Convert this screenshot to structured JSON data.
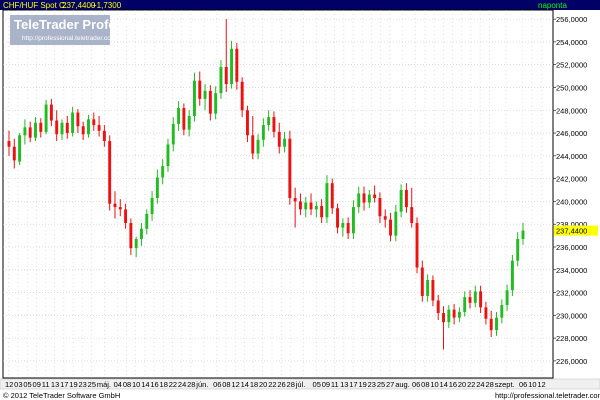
{
  "header": {
    "symbol": "CHF/HUF Spot C:",
    "last": "237,4400",
    "change": "+1,7300",
    "interval": "naponta"
  },
  "watermark": {
    "title": "TeleTrader Professional",
    "url": "http://professional.teletrader.com"
  },
  "footer": {
    "copyright": "© 2012 TeleTrader Software GmbH",
    "url": "http://professional.teletrader.com"
  },
  "colors": {
    "up": "#22bb22",
    "down": "#ee1111",
    "header_bg": "#000066",
    "header_text": "#ffff00",
    "grid": "#c8c8c8",
    "last_price_bg": "#ffff00",
    "bottom_bar": "#f0f0f0"
  },
  "chart_data": {
    "type": "candlestick",
    "ylim": [
      224.5,
      256.8
    ],
    "y_ticks": [
      "256,0000",
      "254,0000",
      "252,0000",
      "250,0000",
      "248,0000",
      "246,0000",
      "244,0000",
      "242,0000",
      "240,0000",
      "238,0000",
      "236,0000",
      "234,0000",
      "232,0000",
      "230,0000",
      "228,0000",
      "226,0000"
    ],
    "last_price_label": "237,4400",
    "x_tick_labels": [
      "12",
      "03",
      "05",
      "09",
      "11",
      "13",
      "17",
      "19",
      "23",
      "25",
      "máj.",
      "04",
      "08",
      "10",
      "14",
      "16",
      "18",
      "22",
      "24",
      "28",
      "jún.",
      "06",
      "08",
      "12",
      "14",
      "18",
      "20",
      "22",
      "26",
      "28",
      "júl.",
      "05",
      "09",
      "11",
      "13",
      "17",
      "19",
      "23",
      "25",
      "27",
      "aug.",
      "06",
      "08",
      "10",
      "14",
      "16",
      "20",
      "22",
      "24",
      "28",
      "szept.",
      "06",
      "10",
      "12"
    ],
    "candles": [
      {
        "o": 245.3,
        "h": 246.2,
        "l": 244.0,
        "c": 244.8
      },
      {
        "o": 244.8,
        "h": 245.5,
        "l": 242.9,
        "c": 243.6
      },
      {
        "o": 243.5,
        "h": 246.0,
        "l": 243.2,
        "c": 245.8
      },
      {
        "o": 245.8,
        "h": 247.2,
        "l": 245.0,
        "c": 246.5
      },
      {
        "o": 246.5,
        "h": 247.0,
        "l": 245.2,
        "c": 245.6
      },
      {
        "o": 245.6,
        "h": 247.4,
        "l": 245.3,
        "c": 246.9
      },
      {
        "o": 246.9,
        "h": 247.3,
        "l": 245.6,
        "c": 246.1
      },
      {
        "o": 246.1,
        "h": 248.9,
        "l": 245.9,
        "c": 248.5
      },
      {
        "o": 248.5,
        "h": 249.0,
        "l": 246.6,
        "c": 247.1
      },
      {
        "o": 247.1,
        "h": 248.0,
        "l": 245.3,
        "c": 245.9
      },
      {
        "o": 245.9,
        "h": 247.2,
        "l": 245.4,
        "c": 246.9
      },
      {
        "o": 246.9,
        "h": 247.5,
        "l": 245.5,
        "c": 246.0
      },
      {
        "o": 246.0,
        "h": 248.3,
        "l": 245.7,
        "c": 247.8
      },
      {
        "o": 247.8,
        "h": 248.1,
        "l": 246.0,
        "c": 246.6
      },
      {
        "o": 246.6,
        "h": 247.0,
        "l": 245.4,
        "c": 245.9
      },
      {
        "o": 245.9,
        "h": 247.6,
        "l": 245.6,
        "c": 247.2
      },
      {
        "o": 247.2,
        "h": 247.8,
        "l": 246.2,
        "c": 246.7
      },
      {
        "o": 246.7,
        "h": 247.5,
        "l": 245.7,
        "c": 246.2
      },
      {
        "o": 246.2,
        "h": 246.7,
        "l": 244.8,
        "c": 245.3
      },
      {
        "o": 245.3,
        "h": 245.8,
        "l": 239.2,
        "c": 239.8
      },
      {
        "o": 239.8,
        "h": 240.9,
        "l": 238.5,
        "c": 239.5
      },
      {
        "o": 239.5,
        "h": 240.2,
        "l": 238.7,
        "c": 239.3
      },
      {
        "o": 239.3,
        "h": 239.8,
        "l": 237.6,
        "c": 238.1
      },
      {
        "o": 238.1,
        "h": 238.5,
        "l": 235.3,
        "c": 235.9
      },
      {
        "o": 235.9,
        "h": 236.9,
        "l": 235.1,
        "c": 236.7
      },
      {
        "o": 236.7,
        "h": 238.1,
        "l": 236.1,
        "c": 237.6
      },
      {
        "o": 237.6,
        "h": 239.3,
        "l": 237.1,
        "c": 238.9
      },
      {
        "o": 238.9,
        "h": 240.9,
        "l": 238.3,
        "c": 240.3
      },
      {
        "o": 240.3,
        "h": 242.8,
        "l": 239.8,
        "c": 242.1
      },
      {
        "o": 242.1,
        "h": 243.7,
        "l": 241.5,
        "c": 243.1
      },
      {
        "o": 243.1,
        "h": 245.5,
        "l": 242.6,
        "c": 245.0
      },
      {
        "o": 245.0,
        "h": 247.4,
        "l": 244.4,
        "c": 246.8
      },
      {
        "o": 246.8,
        "h": 248.8,
        "l": 246.2,
        "c": 248.2
      },
      {
        "o": 248.2,
        "h": 248.6,
        "l": 245.8,
        "c": 246.3
      },
      {
        "o": 246.3,
        "h": 248.0,
        "l": 245.7,
        "c": 247.5
      },
      {
        "o": 247.5,
        "h": 251.3,
        "l": 247.0,
        "c": 250.6
      },
      {
        "o": 250.6,
        "h": 251.4,
        "l": 248.4,
        "c": 249.0
      },
      {
        "o": 249.0,
        "h": 250.3,
        "l": 248.0,
        "c": 249.7
      },
      {
        "o": 249.7,
        "h": 250.2,
        "l": 247.1,
        "c": 247.7
      },
      {
        "o": 247.7,
        "h": 250.1,
        "l": 247.2,
        "c": 249.5
      },
      {
        "o": 249.5,
        "h": 252.4,
        "l": 249.0,
        "c": 251.8
      },
      {
        "o": 251.8,
        "h": 256.0,
        "l": 249.6,
        "c": 250.3
      },
      {
        "o": 250.3,
        "h": 254.1,
        "l": 249.9,
        "c": 253.4
      },
      {
        "o": 253.4,
        "h": 253.9,
        "l": 249.8,
        "c": 250.5
      },
      {
        "o": 250.5,
        "h": 250.9,
        "l": 247.4,
        "c": 248.0
      },
      {
        "o": 248.0,
        "h": 248.4,
        "l": 245.2,
        "c": 245.8
      },
      {
        "o": 245.8,
        "h": 247.5,
        "l": 243.7,
        "c": 244.2
      },
      {
        "o": 244.2,
        "h": 245.9,
        "l": 243.7,
        "c": 245.4
      },
      {
        "o": 245.4,
        "h": 247.3,
        "l": 244.8,
        "c": 246.7
      },
      {
        "o": 246.7,
        "h": 248.0,
        "l": 246.2,
        "c": 247.4
      },
      {
        "o": 247.4,
        "h": 247.9,
        "l": 245.6,
        "c": 246.1
      },
      {
        "o": 246.1,
        "h": 246.9,
        "l": 244.2,
        "c": 244.8
      },
      {
        "o": 244.8,
        "h": 246.1,
        "l": 244.3,
        "c": 245.5
      },
      {
        "o": 245.5,
        "h": 246.2,
        "l": 239.7,
        "c": 240.3
      },
      {
        "o": 240.3,
        "h": 241.2,
        "l": 237.7,
        "c": 240.0
      },
      {
        "o": 240.0,
        "h": 240.7,
        "l": 238.8,
        "c": 239.3
      },
      {
        "o": 239.3,
        "h": 240.4,
        "l": 238.6,
        "c": 239.9
      },
      {
        "o": 239.9,
        "h": 240.7,
        "l": 238.8,
        "c": 239.3
      },
      {
        "o": 239.3,
        "h": 240.0,
        "l": 238.6,
        "c": 239.6
      },
      {
        "o": 239.6,
        "h": 240.2,
        "l": 238.1,
        "c": 238.6
      },
      {
        "o": 238.6,
        "h": 242.3,
        "l": 238.1,
        "c": 241.6
      },
      {
        "o": 241.6,
        "h": 242.0,
        "l": 238.9,
        "c": 239.4
      },
      {
        "o": 239.4,
        "h": 239.8,
        "l": 237.2,
        "c": 237.7
      },
      {
        "o": 237.7,
        "h": 238.5,
        "l": 236.9,
        "c": 238.1
      },
      {
        "o": 238.1,
        "h": 238.6,
        "l": 236.7,
        "c": 237.2
      },
      {
        "o": 237.2,
        "h": 240.1,
        "l": 236.7,
        "c": 239.5
      },
      {
        "o": 239.5,
        "h": 241.3,
        "l": 239.0,
        "c": 240.7
      },
      {
        "o": 240.7,
        "h": 241.3,
        "l": 239.2,
        "c": 239.9
      },
      {
        "o": 239.9,
        "h": 241.0,
        "l": 239.4,
        "c": 240.6
      },
      {
        "o": 240.6,
        "h": 241.4,
        "l": 239.9,
        "c": 240.3
      },
      {
        "o": 240.3,
        "h": 240.8,
        "l": 238.1,
        "c": 238.7
      },
      {
        "o": 238.7,
        "h": 239.3,
        "l": 237.7,
        "c": 238.4
      },
      {
        "o": 238.4,
        "h": 239.0,
        "l": 236.5,
        "c": 237.0
      },
      {
        "o": 237.0,
        "h": 239.7,
        "l": 236.5,
        "c": 239.1
      },
      {
        "o": 239.1,
        "h": 241.5,
        "l": 238.6,
        "c": 241.0
      },
      {
        "o": 241.0,
        "h": 241.6,
        "l": 239.0,
        "c": 239.5
      },
      {
        "o": 239.5,
        "h": 241.2,
        "l": 237.7,
        "c": 238.1
      },
      {
        "o": 238.1,
        "h": 238.6,
        "l": 233.7,
        "c": 234.2
      },
      {
        "o": 234.2,
        "h": 234.8,
        "l": 231.2,
        "c": 231.7
      },
      {
        "o": 231.7,
        "h": 233.6,
        "l": 231.2,
        "c": 233.1
      },
      {
        "o": 233.1,
        "h": 233.5,
        "l": 230.8,
        "c": 231.3
      },
      {
        "o": 231.3,
        "h": 231.8,
        "l": 229.6,
        "c": 230.2
      },
      {
        "o": 230.2,
        "h": 230.8,
        "l": 227.0,
        "c": 229.4
      },
      {
        "o": 229.4,
        "h": 230.9,
        "l": 228.9,
        "c": 230.5
      },
      {
        "o": 230.5,
        "h": 231.0,
        "l": 229.2,
        "c": 229.8
      },
      {
        "o": 229.8,
        "h": 230.7,
        "l": 229.4,
        "c": 230.3
      },
      {
        "o": 230.3,
        "h": 232.1,
        "l": 229.9,
        "c": 231.6
      },
      {
        "o": 231.6,
        "h": 232.2,
        "l": 230.6,
        "c": 231.1
      },
      {
        "o": 231.1,
        "h": 232.6,
        "l": 230.7,
        "c": 232.1
      },
      {
        "o": 232.1,
        "h": 232.6,
        "l": 230.2,
        "c": 230.7
      },
      {
        "o": 230.7,
        "h": 231.2,
        "l": 229.2,
        "c": 229.7
      },
      {
        "o": 229.7,
        "h": 230.4,
        "l": 228.1,
        "c": 228.7
      },
      {
        "o": 228.7,
        "h": 230.3,
        "l": 228.2,
        "c": 229.8
      },
      {
        "o": 229.8,
        "h": 231.4,
        "l": 229.3,
        "c": 230.9
      },
      {
        "o": 230.9,
        "h": 232.7,
        "l": 230.4,
        "c": 232.2
      },
      {
        "o": 232.2,
        "h": 235.3,
        "l": 231.7,
        "c": 234.8
      },
      {
        "o": 234.8,
        "h": 237.3,
        "l": 234.3,
        "c": 236.7
      },
      {
        "o": 236.7,
        "h": 238.1,
        "l": 236.2,
        "c": 237.44
      }
    ]
  }
}
